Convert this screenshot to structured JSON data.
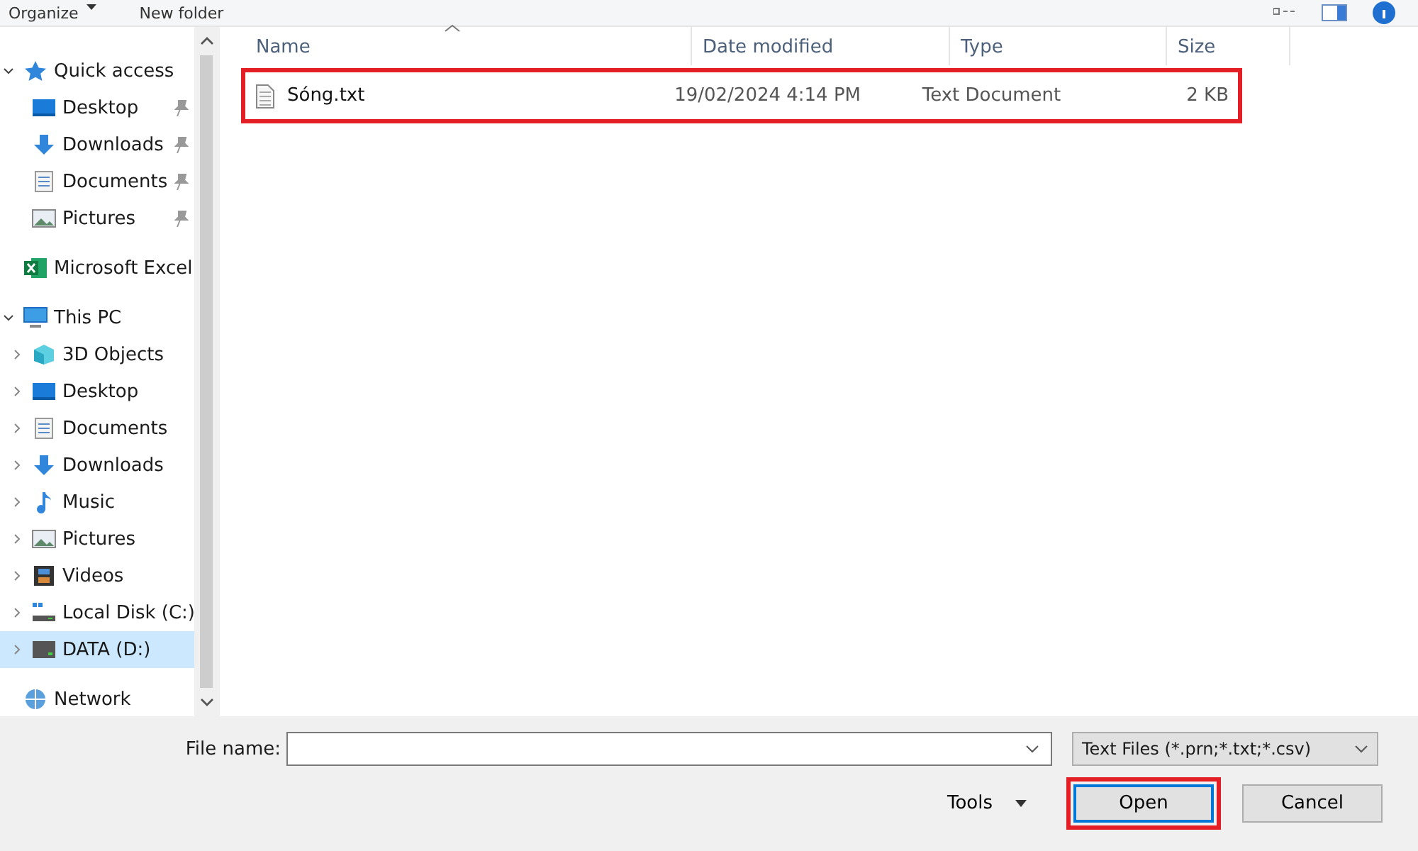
{
  "toolbar": {
    "buttons": [
      {
        "label": "Organize",
        "dropdown": true
      },
      {
        "label": "New folder",
        "dropdown": false
      }
    ]
  },
  "sidebar": {
    "items": [
      {
        "label": "Quick access",
        "kind": "star",
        "expanded": true,
        "selected": false,
        "children": [
          {
            "label": "Desktop",
            "kind": "desktop",
            "pinned": true,
            "selected": false
          },
          {
            "label": "Downloads",
            "kind": "download",
            "pinned": true,
            "selected": false
          },
          {
            "label": "Documents",
            "kind": "document",
            "pinned": true,
            "selected": false
          },
          {
            "label": "Pictures",
            "kind": "picture",
            "pinned": true,
            "selected": false
          }
        ]
      },
      {
        "label": "Microsoft Excel",
        "kind": "excel",
        "expanded": false,
        "selected": false
      },
      {
        "label": "This PC",
        "kind": "pc",
        "expanded": true,
        "selected": false,
        "children": [
          {
            "label": "3D Objects",
            "kind": "cube",
            "expanded": false,
            "selected": false
          },
          {
            "label": "Desktop",
            "kind": "desktop",
            "expanded": false,
            "selected": false
          },
          {
            "label": "Documents",
            "kind": "document",
            "expanded": false,
            "selected": false
          },
          {
            "label": "Downloads",
            "kind": "download",
            "expanded": false,
            "selected": false
          },
          {
            "label": "Music",
            "kind": "music",
            "expanded": false,
            "selected": false
          },
          {
            "label": "Pictures",
            "kind": "picture",
            "expanded": false,
            "selected": false
          },
          {
            "label": "Videos",
            "kind": "video",
            "expanded": false,
            "selected": false
          },
          {
            "label": "Local Disk (C:)",
            "kind": "disk",
            "expanded": false,
            "selected": false
          },
          {
            "label": "DATA (D:)",
            "kind": "drive",
            "expanded": false,
            "selected": true
          }
        ]
      },
      {
        "label": "Network",
        "kind": "network",
        "expanded": false,
        "selected": false
      }
    ]
  },
  "table": {
    "columns": [
      {
        "label": "Name",
        "sorted": true
      },
      {
        "label": "Date modified",
        "sorted": false
      },
      {
        "label": "Type",
        "sorted": false
      },
      {
        "label": "Size",
        "sorted": false
      }
    ],
    "rows": [
      {
        "name": "Sóng.txt",
        "date_modified": "19/02/2024 4:14 PM",
        "type": "Text Document",
        "size": "2 KB",
        "highlighted": true
      }
    ]
  },
  "bottom": {
    "file_name_label": "File name:",
    "filter": "Text Files (*.prn;*.txt;*.csv)",
    "tools": "Tools",
    "buttons": [
      {
        "label": "Open",
        "default": true,
        "highlighted": true
      },
      {
        "label": "Cancel",
        "default": false,
        "highlighted": false
      }
    ]
  }
}
